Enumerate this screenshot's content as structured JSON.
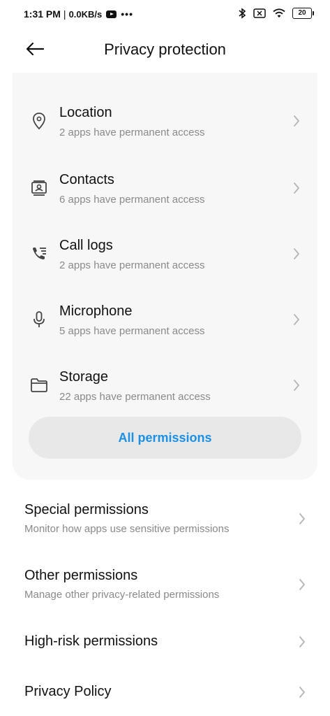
{
  "status_bar": {
    "time": "1:31 PM",
    "separator": "|",
    "speed": "0.0KB/s",
    "dots": "•••",
    "battery": "20",
    "icons": [
      "youtube-icon",
      "bluetooth-icon",
      "no-sim-icon",
      "wifi-icon",
      "battery-icon"
    ]
  },
  "header": {
    "title": "Privacy protection",
    "back_icon": "arrow-left-icon"
  },
  "permissions": [
    {
      "title": "Location",
      "subtitle": "2 apps have permanent access",
      "icon": "location-pin-icon"
    },
    {
      "title": "Contacts",
      "subtitle": "6 apps have permanent access",
      "icon": "contacts-icon"
    },
    {
      "title": "Call logs",
      "subtitle": "2 apps have permanent access",
      "icon": "call-log-icon"
    },
    {
      "title": "Microphone",
      "subtitle": "5 apps have permanent access",
      "icon": "microphone-icon"
    },
    {
      "title": "Storage",
      "subtitle": "22 apps have permanent access",
      "icon": "folder-icon"
    }
  ],
  "all_permissions_label": "All permissions",
  "list": [
    {
      "title": "Special permissions",
      "subtitle": "Monitor how apps use sensitive permissions"
    },
    {
      "title": "Other permissions",
      "subtitle": "Manage other privacy-related permissions"
    },
    {
      "title": "High-risk permissions",
      "subtitle": ""
    },
    {
      "title": "Privacy Policy",
      "subtitle": ""
    }
  ],
  "colors": {
    "accent": "#1a90e8",
    "card_bg": "#f7f7f7",
    "button_bg": "#e8e8e8",
    "subtitle": "#8a8a8a"
  }
}
